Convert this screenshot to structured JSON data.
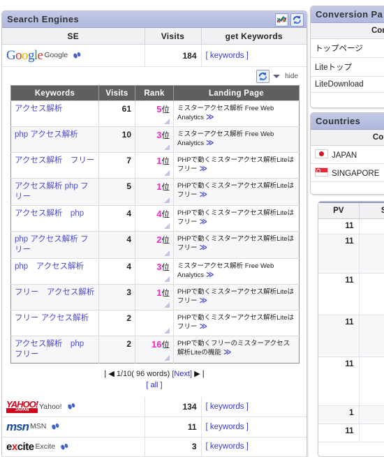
{
  "search_engines_panel": {
    "title": "Search Engines",
    "icons": [
      {
        "name": "chart-icon",
        "label": "chart"
      },
      {
        "name": "refresh-icon",
        "label": "refresh"
      }
    ],
    "columns": [
      "SE",
      "Visits",
      "get Keywords"
    ],
    "rows": [
      {
        "logo": "google",
        "name": "Google",
        "visits": "184",
        "keywords_link": "[ keywords ]"
      },
      {
        "logo": "yahoo",
        "name": "Yahoo!",
        "visits": "134",
        "keywords_link": "[ keywords ]"
      },
      {
        "logo": "msn",
        "name": "MSN",
        "visits": "11",
        "keywords_link": "[ keywords ]"
      },
      {
        "logo": "excite",
        "name": "Excite",
        "visits": "3",
        "keywords_link": "[ keywords ]"
      }
    ],
    "hide_bar": {
      "refresh_icon": "refresh-icon",
      "label": "hide"
    },
    "keyword_table": {
      "columns": [
        "Keywords",
        "Visits",
        "Rank",
        "Landing Page"
      ],
      "rank_unit": "位",
      "rows": [
        {
          "keyword": "アクセス解析",
          "visits": "61",
          "rank": "5",
          "landing": "ミスターアクセス解析 Free Web Analytics",
          "arrow": "≫"
        },
        {
          "keyword": "php アクセス解析",
          "visits": "10",
          "rank": "3",
          "landing": "ミスターアクセス解析 Free Web Analytics",
          "arrow": "≫"
        },
        {
          "keyword": "アクセス解析　フリー",
          "visits": "7",
          "rank": "1",
          "landing": "PHPで動くミスターアクセス解析Liteはフリー",
          "arrow": "≫"
        },
        {
          "keyword": "アクセス解析 php フリー",
          "visits": "5",
          "rank": "1",
          "landing": "PHPで動くミスターアクセス解析Liteはフリー",
          "arrow": "≫"
        },
        {
          "keyword": "アクセス解析　php",
          "visits": "4",
          "rank": "4",
          "landing": "PHPで動くミスターアクセス解析Liteはフリー",
          "arrow": "≫"
        },
        {
          "keyword": "php アクセス解析 フリー",
          "visits": "4",
          "rank": "2",
          "landing": "PHPで動くミスターアクセス解析Liteはフリー",
          "arrow": "≫"
        },
        {
          "keyword": "php　アクセス解析",
          "visits": "4",
          "rank": "3",
          "landing": "ミスターアクセス解析 Free Web Analytics",
          "arrow": "≫"
        },
        {
          "keyword": "フリー　アクセス解析",
          "visits": "3",
          "rank": "1",
          "landing": "PHPで動くミスターアクセス解析Liteはフリー",
          "arrow": "≫"
        },
        {
          "keyword": "フリー アクセス解析",
          "visits": "2",
          "rank": "",
          "landing": "PHPで動くミスターアクセス解析Liteはフリー",
          "arrow": "≫"
        },
        {
          "keyword": "アクセス解析　php　フリー",
          "visits": "2",
          "rank": "16",
          "landing": "PHPで動くフリーのミスターアクセス解析Liteの機能",
          "arrow": "≫"
        }
      ],
      "pager": {
        "first": "❘◀",
        "position": "1/10( 96 words)",
        "next": "[Next]",
        "last": "▶❘",
        "all": "[ all ]"
      }
    }
  },
  "conversion_pages_panel": {
    "title": "Conversion Pa",
    "column": "Convers",
    "rows": [
      {
        "page": "トップページ"
      },
      {
        "page": "Liteトップ"
      },
      {
        "page": "LiteDownload"
      }
    ]
  },
  "countries_panel": {
    "title": "Countries",
    "column": "Country",
    "rows": [
      {
        "flag": "flag-japan-icon",
        "country": "JAPAN"
      },
      {
        "flag": "flag-singapore-icon",
        "country": "SINGAPORE"
      }
    ]
  },
  "pv_panel": {
    "columns": [
      "PV",
      "S"
    ],
    "rows": [
      {
        "pv": "11"
      },
      {
        "pv": "11"
      },
      {
        "pv": "11"
      },
      {
        "pv": "11"
      },
      {
        "pv": "11"
      },
      {
        "pv": "1"
      },
      {
        "pv": "11"
      }
    ]
  },
  "colors": {
    "title_bar": "#b8c0e0",
    "link": "#3a3ad8",
    "rank": "#ff22c8",
    "header_dark": "#5f5f5f"
  }
}
